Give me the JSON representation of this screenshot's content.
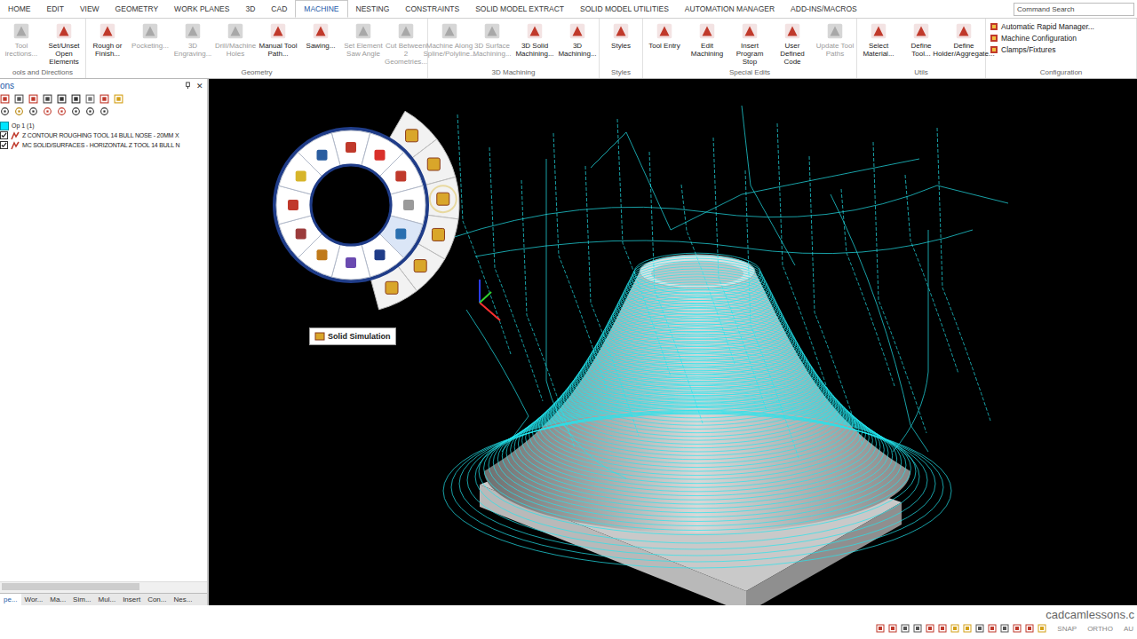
{
  "ribbon_tabs": [
    {
      "label": "HOME",
      "selected": false
    },
    {
      "label": "EDIT",
      "selected": false
    },
    {
      "label": "VIEW",
      "selected": false
    },
    {
      "label": "GEOMETRY",
      "selected": false
    },
    {
      "label": "WORK PLANES",
      "selected": false
    },
    {
      "label": "3D",
      "selected": false
    },
    {
      "label": "CAD",
      "selected": false
    },
    {
      "label": "MACHINE",
      "selected": true
    },
    {
      "label": "NESTING",
      "selected": false
    },
    {
      "label": "CONSTRAINTS",
      "selected": false
    },
    {
      "label": "SOLID MODEL EXTRACT",
      "selected": false
    },
    {
      "label": "SOLID MODEL UTILITIES",
      "selected": false
    },
    {
      "label": "AUTOMATION MANAGER",
      "selected": false
    },
    {
      "label": "ADD-INS/MACROS",
      "selected": false
    }
  ],
  "command_search": {
    "placeholder": "Command Search"
  },
  "ribbon_groups": [
    {
      "label": "ools and Directions",
      "buttons": [
        {
          "label": "Tool irections...",
          "disabled": true
        },
        {
          "label": "Set/Unset Open Elements",
          "disabled": false
        }
      ]
    },
    {
      "label": "Geometry",
      "buttons": [
        {
          "label": "Rough or Finish...",
          "disabled": false
        },
        {
          "label": "Pocketing...",
          "disabled": true
        },
        {
          "label": "3D Engraving...",
          "disabled": true
        },
        {
          "label": "Drill/Machine Holes",
          "disabled": true
        },
        {
          "label": "Manual Tool Path...",
          "disabled": false
        },
        {
          "label": "Sawing...",
          "disabled": false
        },
        {
          "label": "Set Element Saw Angle",
          "disabled": true
        },
        {
          "label": "Cut Between 2 Geometries...",
          "disabled": true
        }
      ]
    },
    {
      "label": "3D Machining",
      "buttons": [
        {
          "label": "Machine Along Spline/Polyline...",
          "disabled": true
        },
        {
          "label": "3D Surface Machining...",
          "disabled": true
        },
        {
          "label": "3D Solid Machining...",
          "disabled": false
        },
        {
          "label": "3D Machining...",
          "disabled": false
        }
      ]
    },
    {
      "label": "Styles",
      "buttons": [
        {
          "label": "Styles",
          "disabled": false
        }
      ]
    },
    {
      "label": "Special Edits",
      "buttons": [
        {
          "label": "Tool Entry",
          "disabled": false
        },
        {
          "label": "Edit Machining",
          "disabled": false
        },
        {
          "label": "Insert Program Stop",
          "disabled": false
        },
        {
          "label": "User Defined Code",
          "disabled": false
        },
        {
          "label": "Update Tool Paths",
          "disabled": true
        }
      ]
    },
    {
      "label": "Utils",
      "buttons": [
        {
          "label": "Select Material...",
          "disabled": false
        },
        {
          "label": "Define Tool...",
          "disabled": false
        },
        {
          "label": "Define Holder/Aggregate...",
          "disabled": false
        }
      ]
    }
  ],
  "configuration": {
    "label": "Configuration",
    "items": [
      "Automatic Rapid Manager...",
      "Machine Configuration",
      "Clamps/Fixtures"
    ]
  },
  "panel": {
    "title": "ons",
    "close": "✕"
  },
  "tree": {
    "group": "Op 1  (1)",
    "operations": [
      {
        "label": "Z CONTOUR ROUGHING   TOOL 14   BULL NOSE - 20MM X",
        "checked": true
      },
      {
        "label": "MC SOLID/SURFACES - HORIZONTAL Z   TOOL 14   BULL N",
        "checked": true
      }
    ]
  },
  "panel_tabs": [
    {
      "label": "pe...",
      "selected": true
    },
    {
      "label": "Wor...",
      "selected": false
    },
    {
      "label": "Ma...",
      "selected": false
    },
    {
      "label": "Sim...",
      "selected": false
    },
    {
      "label": "Mul...",
      "selected": false
    },
    {
      "label": "Insert",
      "selected": false
    },
    {
      "label": "Con...",
      "selected": false
    },
    {
      "label": "Nes...",
      "selected": false
    }
  ],
  "viewport": {
    "tooltip": "Solid Simulation"
  },
  "watermark": "cadcamlessons.c",
  "status_bar": {
    "toggles": [
      "SNAP",
      "ORTHO",
      "AU"
    ]
  }
}
